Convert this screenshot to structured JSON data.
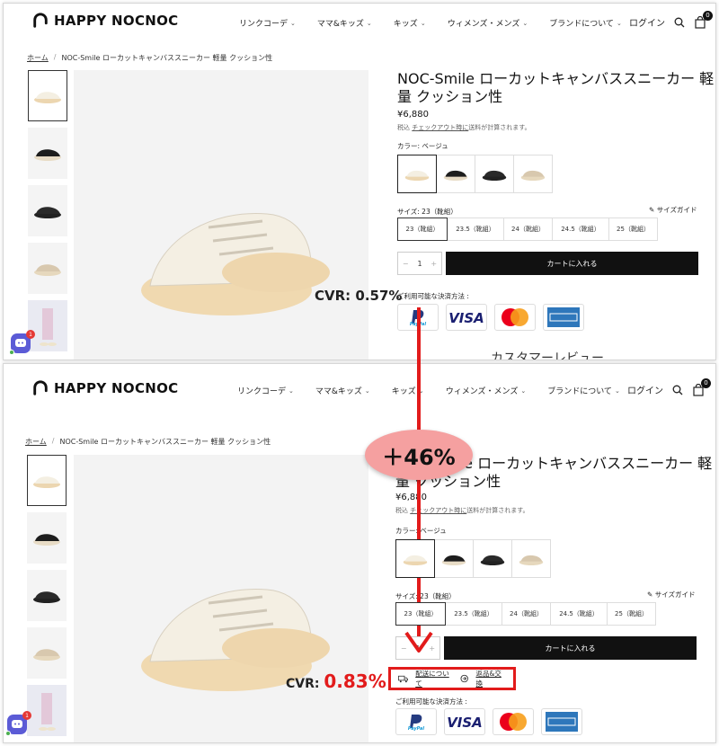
{
  "brand": "HAPPY NOCNOC",
  "nav": [
    "リンクコーデ",
    "ママ&キッズ",
    "キッズ",
    "ウィメンズ・メンズ",
    "ブランドについて"
  ],
  "login": "ログイン",
  "cart_count": "0",
  "breadcrumb": {
    "home": "ホーム",
    "current": "NOC-Smile ローカットキャンバススニーカー 軽量 クッション性"
  },
  "product": {
    "title_line1": "NOC-Smile ローカットキャンバススニーカー 軽",
    "title_line2": "量 クッション性",
    "price": "¥6,880",
    "tax_prefix": "税込",
    "tax_link": "チェックアウト時に",
    "tax_suffix": "送料が計算されます。",
    "color_label": "カラー: ベージュ",
    "size_label": "サイズ: 23（靴組）",
    "size_guide": "サイズガイド",
    "sizes": [
      "23（靴組）",
      "23.5（靴組）",
      "24（靴組）",
      "24.5（靴組）",
      "25（靴組）"
    ],
    "qty": "1",
    "add_to_cart": "カートに入れる",
    "payment_label": "ご利用可能な決済方法 :",
    "shipping_link": "配送について",
    "returns_link": "返品&交換"
  },
  "reviews_heading": "カスタマーレビュー",
  "chat_badge": "1",
  "annotation": {
    "cvr_before_label": "CVR: ",
    "cvr_before_value": "0.57%",
    "cvr_after_label": "CVR: ",
    "cvr_after_value": "0.83%",
    "uplift": "＋46%"
  },
  "colors": {
    "accent_red": "#e21b1b",
    "bubble": "#f5a0a0",
    "button": "#111111"
  }
}
